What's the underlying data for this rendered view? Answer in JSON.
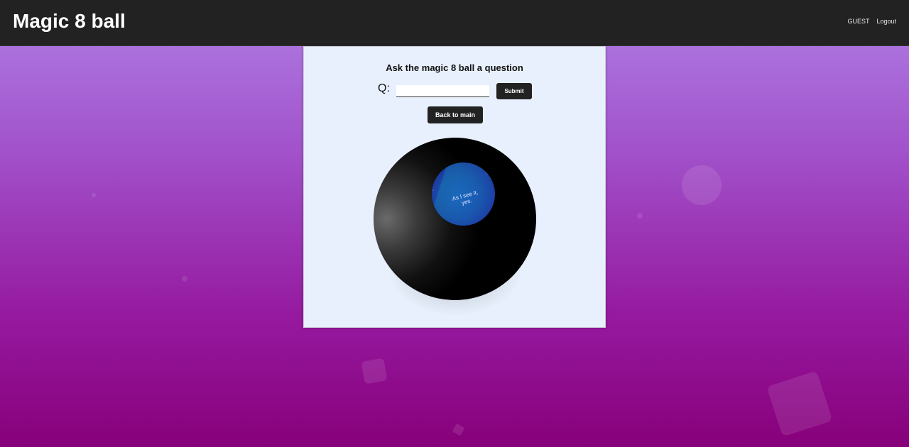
{
  "header": {
    "title": "Magic 8 ball",
    "user_label": "GUEST",
    "logout_label": "Logout"
  },
  "card": {
    "heading": "Ask the magic 8 ball a question",
    "question_label": "Q:",
    "question_value": "",
    "submit_label": "Submit",
    "back_label": "Back to main"
  },
  "ball": {
    "answer": "As I see it, yes.",
    "fragment_left": "...",
    "fragment_right": "..."
  },
  "colors": {
    "header_bg": "#222222",
    "card_bg": "#e8f0fd",
    "button_bg": "#222222",
    "gradient_top": "#b07fe6",
    "gradient_bottom": "#87007a",
    "window_blue": "#1a4aa8"
  }
}
